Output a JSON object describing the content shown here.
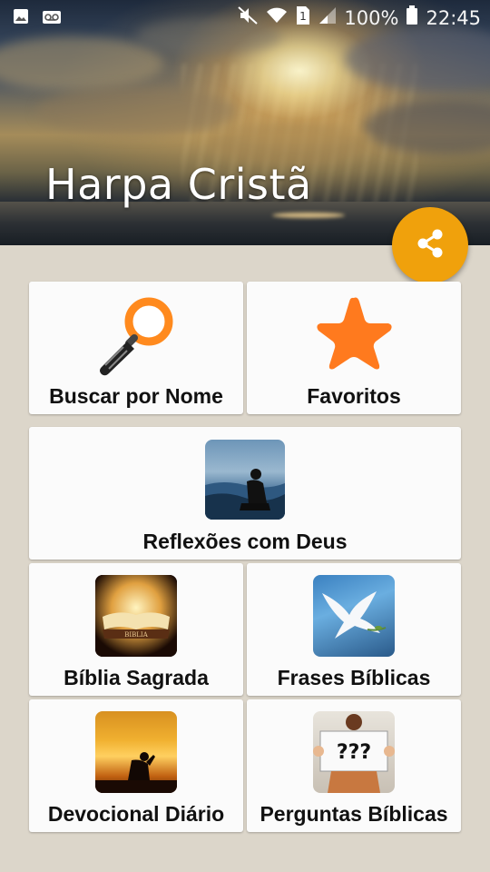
{
  "status_bar": {
    "battery_percent": "100%",
    "time": "22:45",
    "sim_slot": "1",
    "icons": [
      "image-icon",
      "voicemail-icon",
      "mute-icon",
      "wifi-icon",
      "sim-icon",
      "signal-icon",
      "battery-icon"
    ]
  },
  "header": {
    "title": "Harpa Cristã"
  },
  "fab": {
    "icon": "share-icon",
    "color": "#f0a10c"
  },
  "menu": {
    "search": {
      "label": "Buscar por Nome",
      "icon": "magnifier-icon"
    },
    "favorites": {
      "label": "Favoritos",
      "icon": "star-icon"
    },
    "reflections": {
      "label": "Reflexões com Deus",
      "icon": "man-by-sea-image"
    },
    "bible": {
      "label": "Bíblia Sagrada",
      "icon": "bible-book-image",
      "image_text": "BIBLIA"
    },
    "phrases": {
      "label": "Frases Bíblicas",
      "icon": "dove-image"
    },
    "devotional": {
      "label": "Devocional Diário",
      "icon": "praying-silhouette-image"
    },
    "questions": {
      "label": "Perguntas Bíblicas",
      "icon": "question-sign-image",
      "image_text": "???"
    }
  },
  "colors": {
    "background": "#dcd6ca",
    "tile": "#fbfbfb",
    "accent": "#f0a10c",
    "star": "#ff7a1e"
  }
}
